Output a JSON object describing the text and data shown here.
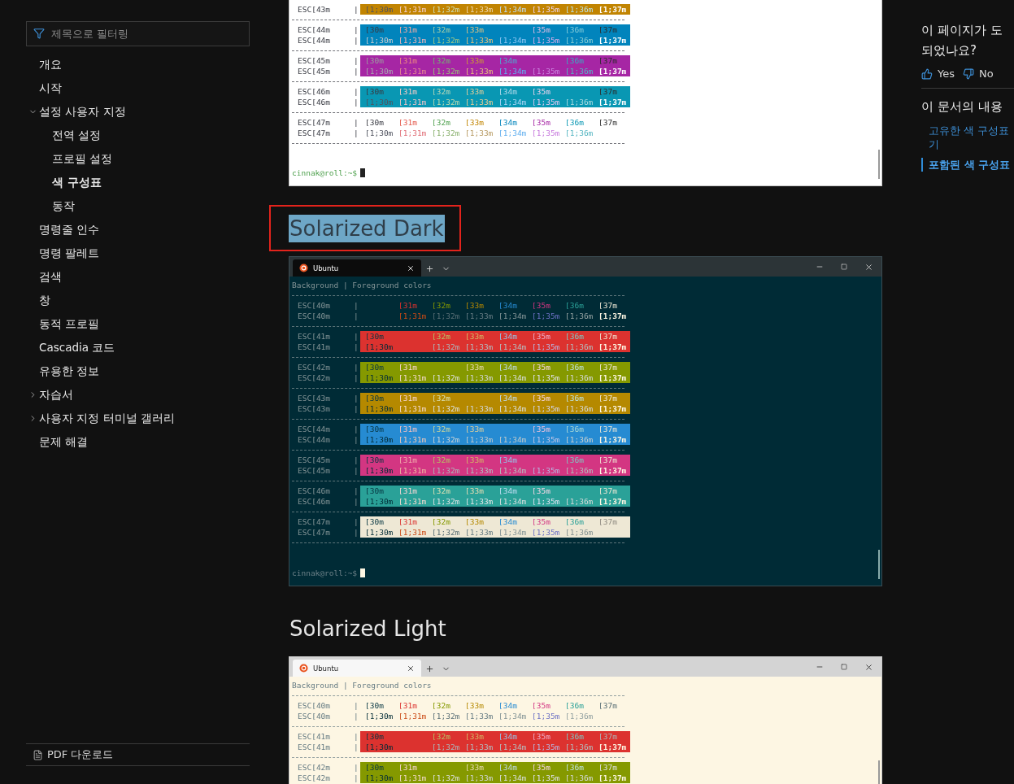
{
  "sidebar": {
    "filter": {
      "placeholder": "제목으로 필터링"
    },
    "items": [
      {
        "label": "개요",
        "kind": "page",
        "selected": false
      },
      {
        "label": "시작",
        "kind": "page",
        "selected": false
      },
      {
        "label": "설정 사용자 지정",
        "kind": "group",
        "expanded": true,
        "selected": false,
        "children": [
          {
            "label": "전역 설정",
            "kind": "page",
            "selected": false
          },
          {
            "label": "프로필 설정",
            "kind": "page",
            "selected": false
          },
          {
            "label": "색 구성표",
            "kind": "page",
            "selected": true
          },
          {
            "label": "동작",
            "kind": "page",
            "selected": false
          }
        ]
      },
      {
        "label": "명령줄 인수",
        "kind": "page",
        "selected": false
      },
      {
        "label": "명령 팔레트",
        "kind": "page",
        "selected": false
      },
      {
        "label": "검색",
        "kind": "page",
        "selected": false
      },
      {
        "label": "창",
        "kind": "page",
        "selected": false
      },
      {
        "label": "동적 프로필",
        "kind": "page",
        "selected": false
      },
      {
        "label": "Cascadia 코드",
        "kind": "page",
        "selected": false
      },
      {
        "label": "유용한 정보",
        "kind": "page",
        "selected": false
      },
      {
        "label": "자습서",
        "kind": "group",
        "expanded": false,
        "selected": false
      },
      {
        "label": "사용자 지정 터미널 갤러리",
        "kind": "group",
        "expanded": false,
        "selected": false
      },
      {
        "label": "문제 해결",
        "kind": "page",
        "selected": false
      }
    ],
    "pdf_download": "PDF 다운로드"
  },
  "content": [
    {
      "kind": "plainterminal",
      "color": "#ffffff",
      "rows": [
        {
          "color": "#c18401",
          "lines": [
            {
              "kind": "bold",
              "label": "ESC[43m",
              "pipe": "|",
              "cells": [
                "[1;30m",
                "[1;31m",
                "[1;32m",
                "[1;33m",
                "[1;34m",
                "[1;35m",
                "[1;36m",
                "[1;37m"
              ]
            }
          ]
        },
        {
          "color": "#0184bc",
          "lines": [
            {
              "kind": "normal",
              "label": "ESC[44m",
              "pipe": "|",
              "cells": [
                "[30m",
                "[31m",
                "[32m",
                "[33m",
                null,
                "[35m",
                "[36m",
                "[37m"
              ]
            },
            {
              "kind": "bold",
              "label": "ESC[44m",
              "pipe": "|",
              "cells": [
                "[1;30m",
                "[1;31m",
                "[1;32m",
                "[1;33m",
                "[1;34m",
                "[1;35m",
                "[1;36m",
                "[1;37m"
              ]
            }
          ]
        },
        {
          "color": "#a626a4",
          "lines": [
            {
              "kind": "normal",
              "label": "ESC[45m",
              "pipe": "|",
              "cells": [
                "[30m",
                "[31m",
                "[32m",
                "[33m",
                "[34m",
                null,
                "[36m",
                "[37m"
              ]
            },
            {
              "kind": "bold",
              "label": "ESC[45m",
              "pipe": "|",
              "cells": [
                "[1;30m",
                "[1;31m",
                "[1;32m",
                "[1;33m",
                "[1;34m",
                "[1;35m",
                "[1;36m",
                "[1;37m"
              ]
            }
          ]
        },
        {
          "color": "#0997b3",
          "lines": [
            {
              "kind": "normal",
              "label": "ESC[46m",
              "pipe": "|",
              "cells": [
                "[30m",
                "[31m",
                "[32m",
                "[33m",
                "[34m",
                "[35m",
                null,
                "[37m"
              ]
            },
            {
              "kind": "bold",
              "label": "ESC[46m",
              "pipe": "|",
              "cells": [
                "[1;30m",
                "[1;31m",
                "[1;32m",
                "[1;33m",
                "[1;34m",
                "[1;35m",
                "[1;36m",
                "[1;37m"
              ]
            }
          ]
        },
        {
          "color": null,
          "lines": [
            {
              "kind": "normal",
              "label": "ESC[47m",
              "pipe": "|",
              "cells": [
                "[30m",
                "[31m",
                "[32m",
                "[33m",
                "[34m",
                "[35m",
                "[36m",
                "[37m"
              ]
            },
            {
              "kind": "bold",
              "label": "ESC[47m",
              "pipe": "|",
              "cells": [
                "[1;30m",
                "[1;31m",
                "[1;32m",
                "[1;33m",
                "[1;34m",
                "[1;35m",
                "[1;36m",
                null
              ]
            }
          ]
        }
      ],
      "prompt": "cinnak@roll:~$"
    },
    {
      "kind": "heading",
      "text": "Solarized Dark",
      "highlighted": true
    },
    {
      "kind": "darkterminal",
      "color": "#002b36",
      "tab_title": "Ubuntu",
      "header": "Background | Foreground colors",
      "rows": [
        {
          "color": null,
          "lines": [
            {
              "kind": "normal",
              "label": "ESC[40m",
              "pipe": "|",
              "cells": [
                null,
                "[31m",
                "[32m",
                "[33m",
                "[34m",
                "[35m",
                "[36m",
                "[37m"
              ]
            },
            {
              "kind": "bold",
              "label": "ESC[40m",
              "pipe": "|",
              "cells": [
                null,
                "[1;31m",
                "[1;32m",
                "[1;33m",
                "[1;34m",
                "[1;35m",
                "[1;36m",
                "[1;37m"
              ]
            }
          ]
        },
        {
          "color": "#dc322f",
          "lines": [
            {
              "kind": "normal",
              "label": "ESC[41m",
              "pipe": "|",
              "cells": [
                "[30m",
                null,
                "[32m",
                "[33m",
                "[34m",
                "[35m",
                "[36m",
                "[37m"
              ]
            },
            {
              "kind": "bold",
              "label": "ESC[41m",
              "pipe": "|",
              "cells": [
                "[1;30m",
                null,
                "[1;32m",
                "[1;33m",
                "[1;34m",
                "[1;35m",
                "[1;36m",
                "[1;37m"
              ]
            }
          ]
        },
        {
          "color": "#859900",
          "lines": [
            {
              "kind": "normal",
              "label": "ESC[42m",
              "pipe": "|",
              "cells": [
                "[30m",
                "[31m",
                null,
                "[33m",
                "[34m",
                "[35m",
                "[36m",
                "[37m"
              ]
            },
            {
              "kind": "bold",
              "label": "ESC[42m",
              "pipe": "|",
              "cells": [
                "[1;30m",
                "[1;31m",
                "[1;32m",
                "[1;33m",
                "[1;34m",
                "[1;35m",
                "[1;36m",
                "[1;37m"
              ]
            }
          ]
        },
        {
          "color": "#b58900",
          "lines": [
            {
              "kind": "normal",
              "label": "ESC[43m",
              "pipe": "|",
              "cells": [
                "[30m",
                "[31m",
                "[32m",
                null,
                "[34m",
                "[35m",
                "[36m",
                "[37m"
              ]
            },
            {
              "kind": "bold",
              "label": "ESC[43m",
              "pipe": "|",
              "cells": [
                "[1;30m",
                "[1;31m",
                "[1;32m",
                "[1;33m",
                "[1;34m",
                "[1;35m",
                "[1;36m",
                "[1;37m"
              ]
            }
          ]
        },
        {
          "color": "#268bd2",
          "lines": [
            {
              "kind": "normal",
              "label": "ESC[44m",
              "pipe": "|",
              "cells": [
                "[30m",
                "[31m",
                "[32m",
                "[33m",
                null,
                "[35m",
                "[36m",
                "[37m"
              ]
            },
            {
              "kind": "bold",
              "label": "ESC[44m",
              "pipe": "|",
              "cells": [
                "[1;30m",
                "[1;31m",
                "[1;32m",
                "[1;33m",
                "[1;34m",
                "[1;35m",
                "[1;36m",
                "[1;37m"
              ]
            }
          ]
        },
        {
          "color": "#d33682",
          "lines": [
            {
              "kind": "normal",
              "label": "ESC[45m",
              "pipe": "|",
              "cells": [
                "[30m",
                "[31m",
                "[32m",
                "[33m",
                "[34m",
                null,
                "[36m",
                "[37m"
              ]
            },
            {
              "kind": "bold",
              "label": "ESC[45m",
              "pipe": "|",
              "cells": [
                "[1;30m",
                "[1;31m",
                "[1;32m",
                "[1;33m",
                "[1;34m",
                "[1;35m",
                "[1;36m",
                "[1;37m"
              ]
            }
          ]
        },
        {
          "color": "#2aa198",
          "lines": [
            {
              "kind": "normal",
              "label": "ESC[46m",
              "pipe": "|",
              "cells": [
                "[30m",
                "[31m",
                "[32m",
                "[33m",
                "[34m",
                "[35m",
                null,
                "[37m"
              ]
            },
            {
              "kind": "bold",
              "label": "ESC[46m",
              "pipe": "|",
              "cells": [
                "[1;30m",
                "[1;31m",
                "[1;32m",
                "[1;33m",
                "[1;34m",
                "[1;35m",
                "[1;36m",
                "[1;37m"
              ]
            }
          ]
        },
        {
          "color": "#eee8d5",
          "lines": [
            {
              "kind": "normal",
              "label": "ESC[47m",
              "pipe": "|",
              "cells": [
                "[30m",
                "[31m",
                "[32m",
                "[33m",
                "[34m",
                "[35m",
                "[36m",
                "[37m"
              ]
            },
            {
              "kind": "bold",
              "label": "ESC[47m",
              "pipe": "|",
              "cells": [
                "[1;30m",
                "[1;31m",
                "[1;32m",
                "[1;33m",
                "[1;34m",
                "[1;35m",
                "[1;36m",
                null
              ]
            }
          ]
        }
      ],
      "prompt": "cinnak@roll:~$"
    },
    {
      "kind": "heading",
      "text": "Solarized Light",
      "highlighted": false
    },
    {
      "kind": "lightterminal",
      "color": "#fdf6e3",
      "tab_title": "Ubuntu",
      "header": "Background | Foreground colors",
      "rows": [
        {
          "color": null,
          "lines": [
            {
              "kind": "normal",
              "label": "ESC[40m",
              "pipe": "|",
              "cells": [
                "[30m",
                "[31m",
                "[32m",
                "[33m",
                "[34m",
                "[35m",
                "[36m",
                "[37m"
              ]
            },
            {
              "kind": "bold",
              "label": "ESC[40m",
              "pipe": "|",
              "cells": [
                "[1;30m",
                "[1;31m",
                "[1;32m",
                "[1;33m",
                "[1;34m",
                "[1;35m",
                "[1;36m",
                null
              ]
            }
          ]
        },
        {
          "color": "#dc322f",
          "lines": [
            {
              "kind": "normal",
              "label": "ESC[41m",
              "pipe": "|",
              "cells": [
                "[30m",
                null,
                "[32m",
                "[33m",
                "[34m",
                "[35m",
                "[36m",
                "[37m"
              ]
            },
            {
              "kind": "bold",
              "label": "ESC[41m",
              "pipe": "|",
              "cells": [
                "[1;30m",
                null,
                "[1;32m",
                "[1;33m",
                "[1;34m",
                "[1;35m",
                "[1;36m",
                "[1;37m"
              ]
            }
          ]
        },
        {
          "color": "#859900",
          "lines": [
            {
              "kind": "normal",
              "label": "ESC[42m",
              "pipe": "|",
              "cells": [
                "[30m",
                "[31m",
                null,
                "[33m",
                "[34m",
                "[35m",
                "[36m",
                "[37m"
              ]
            },
            {
              "kind": "bold",
              "label": "ESC[42m",
              "pipe": "|",
              "cells": [
                "[1;30m",
                "[1;31m",
                "[1;32m",
                "[1;33m",
                "[1;34m",
                "[1;35m",
                "[1;36m",
                "[1;37m"
              ]
            }
          ]
        }
      ]
    }
  ],
  "aside": {
    "feedback": {
      "title_lines": [
        "이 페이지가 도",
        "되었나요?"
      ],
      "yes": "Yes",
      "no": "No"
    },
    "toc": {
      "title": "이 문서의 내용",
      "links": [
        {
          "lines": [
            "고유한 색 구성표",
            "기"
          ],
          "selected": false
        },
        {
          "lines": [
            "포함된 색 구성표"
          ],
          "selected": true
        }
      ]
    }
  }
}
